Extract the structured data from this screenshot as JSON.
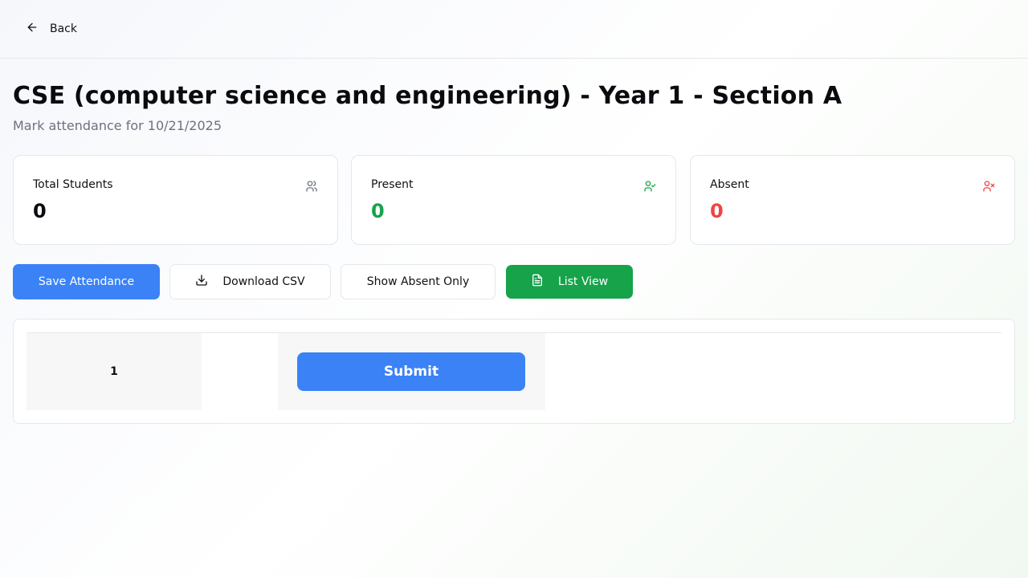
{
  "header": {
    "back_label": "Back"
  },
  "page": {
    "title": "CSE (computer science and engineering) - Year 1 - Section A",
    "subtitle": "Mark attendance for 10/21/2025"
  },
  "stats": {
    "total": {
      "label": "Total Students",
      "value": "0",
      "icon": "users-icon"
    },
    "present": {
      "label": "Present",
      "value": "0",
      "color": "#16a34a",
      "icon": "user-check-icon"
    },
    "absent": {
      "label": "Absent",
      "value": "0",
      "color": "#ef4444",
      "icon": "user-x-icon"
    }
  },
  "actions": {
    "save_label": "Save Attendance",
    "download_label": "Download CSV",
    "absent_only_label": "Show Absent Only",
    "list_view_label": "List View"
  },
  "table": {
    "rows": [
      {
        "number": "1",
        "submit_label": "Submit"
      }
    ]
  },
  "colors": {
    "primary": "#3b82f6",
    "success": "#16a34a",
    "danger": "#ef4444"
  }
}
